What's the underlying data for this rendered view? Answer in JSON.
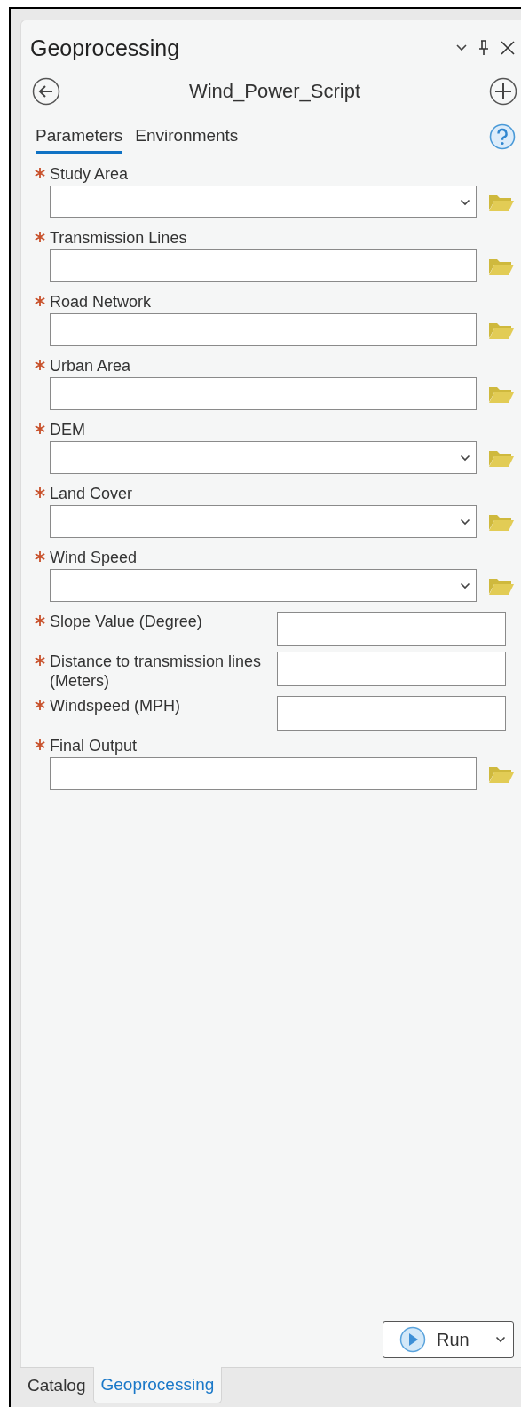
{
  "pane": {
    "title": "Geoprocessing",
    "tool_name": "Wind_Power_Script"
  },
  "tabs": [
    {
      "label": "Parameters",
      "selected": true
    },
    {
      "label": "Environments",
      "selected": false
    }
  ],
  "parameters": [
    {
      "label": "Study Area",
      "required": true,
      "kind": "dropdown"
    },
    {
      "label": "Transmission Lines",
      "required": true,
      "kind": "dataset"
    },
    {
      "label": "Road Network",
      "required": true,
      "kind": "dataset"
    },
    {
      "label": "Urban Area",
      "required": true,
      "kind": "dataset"
    },
    {
      "label": "DEM",
      "required": true,
      "kind": "dropdown"
    },
    {
      "label": "Land Cover",
      "required": true,
      "kind": "dropdown"
    },
    {
      "label": "Wind Speed",
      "required": true,
      "kind": "dropdown"
    },
    {
      "label": "Slope Value (Degree)",
      "required": true,
      "kind": "value"
    },
    {
      "label": "Distance to transmission lines (Meters)",
      "required": true,
      "kind": "value"
    },
    {
      "label": "Windspeed (MPH)",
      "required": true,
      "kind": "value"
    },
    {
      "label": "Final Output",
      "required": true,
      "kind": "dataset"
    }
  ],
  "run_button": {
    "label": "Run"
  },
  "bottom_tabs": [
    {
      "label": "Catalog",
      "selected": false
    },
    {
      "label": "Geoprocessing",
      "selected": true
    }
  ]
}
